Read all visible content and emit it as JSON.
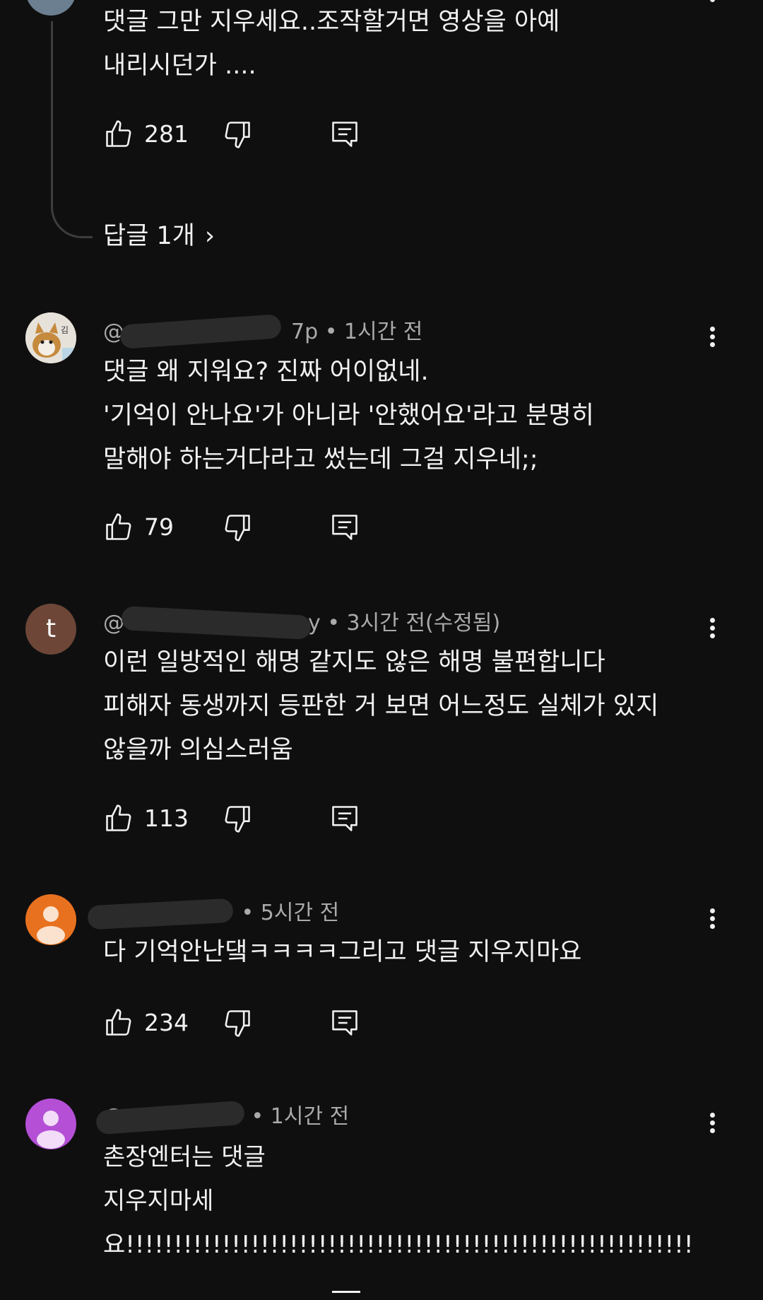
{
  "thread": {
    "top_reply": {
      "text": "댓글 그만 지우세요..조작할거면 영상을 아예\n내리시던가 ....",
      "likes": "281"
    },
    "replies_link": "답글 1개",
    "replies_chevron": "›"
  },
  "comments": [
    {
      "handle": "@",
      "handle_tail": "7p",
      "time": "• 1시간 전",
      "text": "댓글 왜 지워요? 진짜 어이없네.\n'기억이 안나요'가 아니라 '안했어요'라고 분명히\n말해야 하는거다라고 썼는데 그걸 지우네;;",
      "likes": "79",
      "avatar_text": "김"
    },
    {
      "handle": "@",
      "handle_tail": "y",
      "time": "• 3시간 전(수정됨)",
      "text": "이런 일방적인 해명 같지도 않은 해명 불편합니다\n피해자 동생까지 등판한 거 보면 어느정도 실체가 있지\n않을까 의심스러움",
      "likes": "113",
      "avatar_letter": "t"
    },
    {
      "handle": "",
      "handle_tail": "",
      "time": "• 5시간 전",
      "text": "다 기억안난댘ㅋㅋㅋㅋ그리고 댓글 지우지마요",
      "likes": "234"
    },
    {
      "handle": "@",
      "handle_tail": "",
      "time": "• 1시간 전",
      "text": "촌장엔터는 댓글\n지우지마세\n요!!!!!!!!!!!!!!!!!!!!!!!!!!!!!!!!!!!!!!!!!!!!!!!!!!!!!!!!!!!"
    }
  ],
  "colors": {
    "background": "#0f0f0f",
    "text": "#f1f1f1",
    "meta": "#aaaaaa",
    "avatar_t": "#6d4638",
    "avatar_orange": "#e8711f",
    "avatar_purple": "#b44fd6"
  }
}
